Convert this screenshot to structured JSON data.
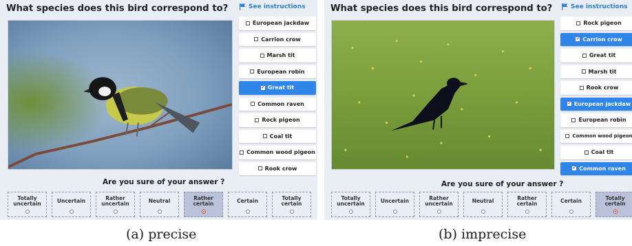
{
  "panel_a": {
    "question": "What species does this bird correspond to?",
    "instructions_label": "See instructions",
    "image_icon": "great-tit-photo",
    "options": [
      {
        "label": "European jackdaw",
        "selected": false
      },
      {
        "label": "Carrion crow",
        "selected": false
      },
      {
        "label": "Marsh tit",
        "selected": false
      },
      {
        "label": "European robin",
        "selected": false
      },
      {
        "label": "Great tit",
        "selected": true
      },
      {
        "label": "Common raven",
        "selected": false
      },
      {
        "label": "Rock pigeon",
        "selected": false
      },
      {
        "label": "Coal tit",
        "selected": false
      },
      {
        "label": "Common wood pigeon",
        "selected": false
      },
      {
        "label": "Rook crow",
        "selected": false
      }
    ],
    "sure_prompt": "Are you sure of your answer ?",
    "confidence": [
      {
        "label": "Totally uncertain",
        "selected": false
      },
      {
        "label": "Uncertain",
        "selected": false
      },
      {
        "label": "Rather uncertain",
        "selected": false
      },
      {
        "label": "Neutral",
        "selected": false
      },
      {
        "label": "Rather certain",
        "selected": true
      },
      {
        "label": "Certain",
        "selected": false
      },
      {
        "label": "Totally certain",
        "selected": false
      }
    ],
    "caption": "(a) precise"
  },
  "panel_b": {
    "question": "What species does this bird correspond to?",
    "instructions_label": "See instructions",
    "image_icon": "crow-on-grass-photo",
    "options": [
      {
        "label": "Rock pigeon",
        "selected": false
      },
      {
        "label": "Carrion crow",
        "selected": true
      },
      {
        "label": "Great tit",
        "selected": false
      },
      {
        "label": "Marsh tit",
        "selected": false
      },
      {
        "label": "Rook crow",
        "selected": false
      },
      {
        "label": "European jackdaw",
        "selected": true
      },
      {
        "label": "European robin",
        "selected": false
      },
      {
        "label": "Common wood pigeon",
        "selected": false
      },
      {
        "label": "Coal tit",
        "selected": false
      },
      {
        "label": "Common raven",
        "selected": true
      }
    ],
    "sure_prompt": "Are you sure of your answer ?",
    "confidence": [
      {
        "label": "Totally uncertain",
        "selected": false
      },
      {
        "label": "Uncertain",
        "selected": false
      },
      {
        "label": "Rather uncertain",
        "selected": false
      },
      {
        "label": "Neutral",
        "selected": false
      },
      {
        "label": "Rather certain",
        "selected": false
      },
      {
        "label": "Certain",
        "selected": false
      },
      {
        "label": "Totally certain",
        "selected": true
      }
    ],
    "caption": "(b) imprecise"
  },
  "colors": {
    "selected_option": "#2f86e8",
    "selected_confidence": "#b9c2d8",
    "check_mark": "#e03a2f",
    "instructions_link": "#2f7fd6"
  }
}
